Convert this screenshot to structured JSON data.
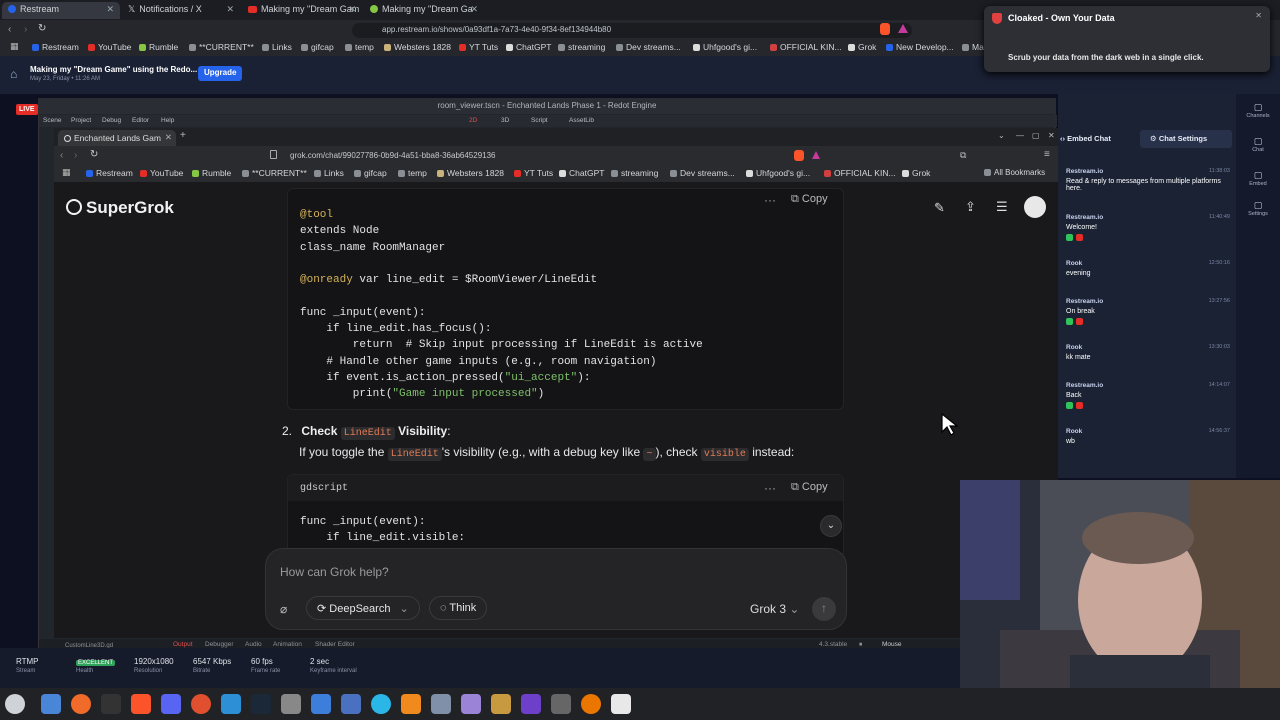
{
  "outer_browser": {
    "tabs": [
      {
        "label": "Restream"
      },
      {
        "label": "Notifications / X"
      },
      {
        "label": "Making my \"Dream Gam"
      },
      {
        "label": "Making my \"Dream Ga"
      }
    ],
    "url": "app.restream.io/shows/0a93df1a-7a73-4e40-9f34-8ef134944b80",
    "bookmarks": [
      "Restream",
      "YouTube",
      "Rumble",
      "**CURRENT**",
      "Links",
      "gifcap",
      "temp",
      "Websters 1828",
      "YT Tuts",
      "ChatGPT",
      "streaming",
      "Dev streams...",
      "Uhfgood's gi...",
      "OFFICIAL KIN...",
      "Grok",
      "New Develop...",
      "Ma"
    ]
  },
  "notification": {
    "title": "Cloaked - Own Your Data",
    "body": "Scrub your data from the dark web in a single click."
  },
  "restream": {
    "show_title": "Making my \"Dream Game\" using the Redo...",
    "show_date": "May 23, Friday • 11:26 AM",
    "upgrade_label": "Upgrade",
    "live_label": "LIVE",
    "embed_chat_label": "Embed Chat",
    "chat_settings_label": "Chat Settings",
    "rail": [
      {
        "label": "Channels",
        "icon": "channels-icon"
      },
      {
        "label": "Chat",
        "icon": "chat-icon"
      },
      {
        "label": "Embed",
        "icon": "embed-icon"
      },
      {
        "label": "Settings",
        "icon": "settings-icon"
      }
    ],
    "chat_messages": [
      {
        "author": "Restream.io",
        "time": "11:38:03",
        "text": "Read & reply to messages from multiple platforms here.",
        "icons": false
      },
      {
        "author": "Restream.io",
        "time": "11:40:49",
        "text": "Welcome!",
        "icons": true
      },
      {
        "author": "Rook",
        "time": "12:50:16",
        "text": "evening",
        "icons": false
      },
      {
        "author": "Restream.io",
        "time": "13:27:56",
        "text": "On break",
        "icons": true
      },
      {
        "author": "Rook",
        "time": "13:30:03",
        "text": "kk mate",
        "icons": false
      },
      {
        "author": "Restream.io",
        "time": "14:14:07",
        "text": "Back",
        "icons": true
      },
      {
        "author": "Rook",
        "time": "14:56:37",
        "text": "wb",
        "icons": false
      }
    ],
    "stats": [
      {
        "value": "RTMP",
        "label": "Stream"
      },
      {
        "value": "EXCELLENT",
        "label": "Health"
      },
      {
        "value": "1920x1080",
        "label": "Resolution"
      },
      {
        "value": "6547 Kbps",
        "label": "Bitrate"
      },
      {
        "value": "60 fps",
        "label": "Frame rate"
      },
      {
        "value": "2 sec",
        "label": "Keyframe interval"
      }
    ]
  },
  "godot": {
    "title": "room_viewer.tscn - Enchanted Lands Phase 1 - Redot Engine",
    "menu": [
      "Scene",
      "Project",
      "Debug",
      "Editor",
      "Help"
    ],
    "workspaces": [
      "2D",
      "3D",
      "Script",
      "AssetLib"
    ],
    "bottom_tabs": [
      "Output",
      "Debugger",
      "Audio",
      "Animation",
      "Shader Editor"
    ],
    "version": "4.3.stable",
    "mouse_label": "Mouse",
    "file_label": "CustomLine3D.gd"
  },
  "inner_browser": {
    "tab_label": "Enchanted Lands Gam",
    "url": "grok.com/chat/99027786-0b9d-4a51-bba8-36ab64529136",
    "bookmarks": [
      "Restream",
      "YouTube",
      "Rumble",
      "**CURRENT**",
      "Links",
      "gifcap",
      "temp",
      "Websters 1828",
      "YT Tuts",
      "ChatGPT",
      "streaming",
      "Dev streams...",
      "Uhfgood's gi...",
      "OFFICIAL KIN...",
      "Grok"
    ],
    "all_bookmarks_label": "All Bookmarks"
  },
  "grok": {
    "logo_text": "SuperGrok",
    "copy_label": "Copy",
    "code1": [
      [
        {
          "t": "@tool",
          "c": "kw"
        }
      ],
      [
        {
          "t": "extends Node",
          "c": ""
        }
      ],
      [
        {
          "t": "class_name RoomManager",
          "c": ""
        }
      ],
      [
        {
          "t": "",
          "c": ""
        }
      ],
      [
        {
          "t": "@onready",
          "c": "kw"
        },
        {
          "t": " var line_edit = $RoomViewer/LineEdit",
          "c": ""
        }
      ],
      [
        {
          "t": "",
          "c": ""
        }
      ],
      [
        {
          "t": "func _input(event):",
          "c": ""
        }
      ],
      [
        {
          "t": "    if line_edit.has_focus():",
          "c": ""
        }
      ],
      [
        {
          "t": "        return  # Skip input processing if LineEdit is active",
          "c": ""
        }
      ],
      [
        {
          "t": "    # Handle other game inputs (e.g., room navigation)",
          "c": ""
        }
      ],
      [
        {
          "t": "    if event.is_action_pressed(",
          "c": ""
        },
        {
          "t": "\"ui_accept\"",
          "c": "str"
        },
        {
          "t": "):",
          "c": ""
        }
      ],
      [
        {
          "t": "        print(",
          "c": ""
        },
        {
          "t": "\"Game input processed\"",
          "c": "str"
        },
        {
          "t": ")",
          "c": ""
        }
      ]
    ],
    "step_number": "2.",
    "step_title_pre": "Check",
    "step_title_code": "LineEdit",
    "step_title_post": "Visibility",
    "step_title_colon": ":",
    "step_body_1": "If you toggle the",
    "step_body_code1": "LineEdit",
    "step_body_2": "'s visibility (e.g., with a debug key like",
    "step_body_code2": "~",
    "step_body_3": "), check",
    "step_body_code3": "visible",
    "step_body_4": "instead:",
    "code2_lang": "gdscript",
    "code2": [
      "func _input(event):",
      "    if line_edit.visible:"
    ],
    "input_placeholder": "How can Grok help?",
    "deepsearch_label": "DeepSearch",
    "think_label": "Think",
    "model_label": "Grok 3"
  },
  "colors": {
    "accent_orange": "#e07b54",
    "restream_blue": "#2563eb",
    "live_red": "#e52d27"
  }
}
